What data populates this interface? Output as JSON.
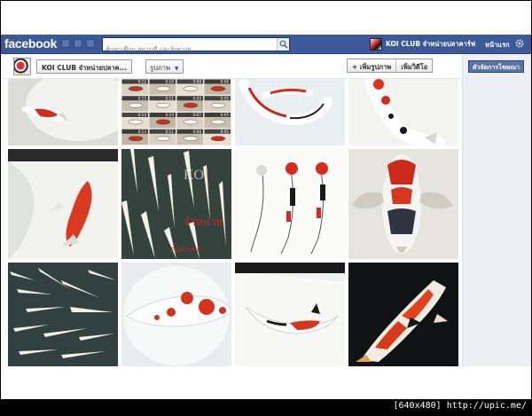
{
  "fb": {
    "logo": "facebook",
    "search_placeholder": "ค้นหาเพื่อน สถานที่ และสิ่งต่างๆ",
    "profile_name": "KOI CLUB จำหน่ายปลาคาร์ฟ",
    "home_label": "หน้าแรก"
  },
  "page": {
    "name_dropdown": "KOI CLUB จำหน่ายปลาค...",
    "photos_dropdown": "รูปภาพ",
    "add_photos": "+ เพิ่มรูปภาพ",
    "add_video": "เพิ่มวิดีโอ",
    "manage_ads": "ตัวจัดการโฆษณา"
  },
  "video_thumbs": {
    "durations": [
      "0:12",
      "0:10",
      "0:08",
      "0:06",
      "0:15",
      "0:11",
      "0:09",
      "0:05",
      "0:14",
      "0:10",
      "0:07",
      "0:05",
      "0:13",
      "0:11",
      "0:08",
      "0:05"
    ]
  },
  "photo_text": {
    "koi_watermark": "KOI",
    "thai_watermark": "จำหน่าย",
    "fortune_watermark": "FORTUNE"
  },
  "footer": {
    "caption": "[640x480] http://upic.me/"
  }
}
